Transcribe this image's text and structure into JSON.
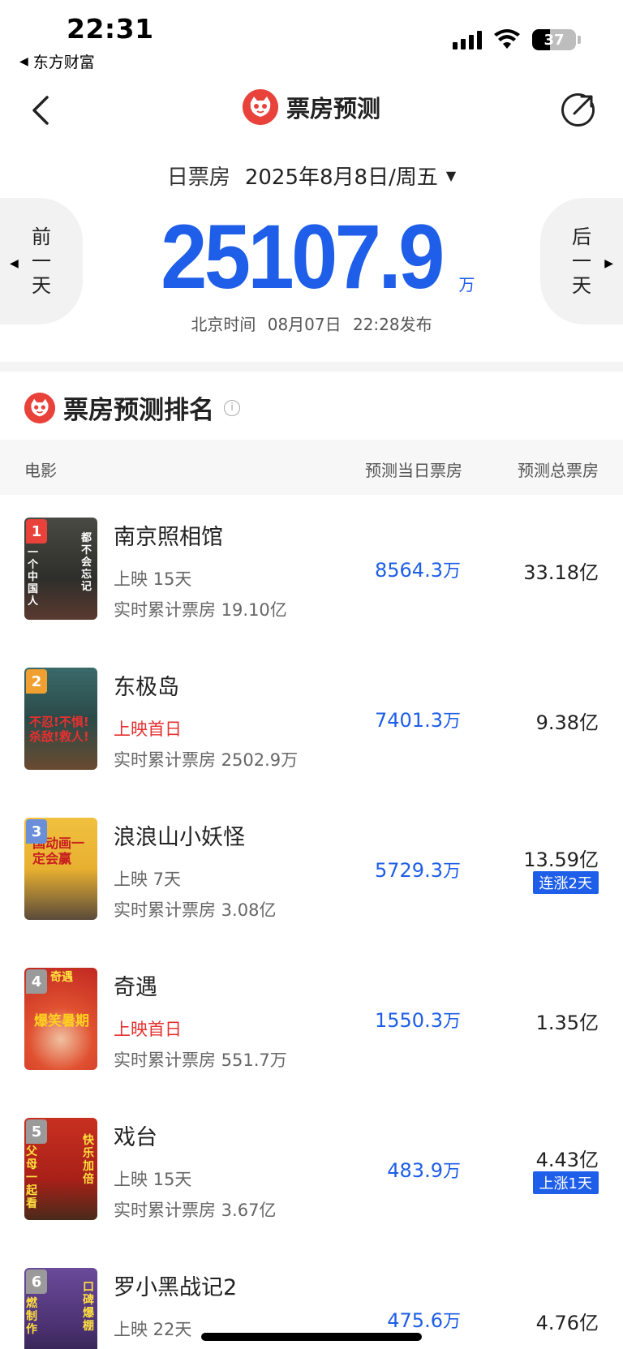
{
  "status_bar": {
    "time": "22:31",
    "back_app": "东方财富",
    "battery": "37"
  },
  "nav": {
    "title": "票房预测"
  },
  "date_section": {
    "label": "日票房",
    "date": "2025年8月8日/周五",
    "prev": [
      "前",
      "一",
      "天"
    ],
    "next": [
      "后",
      "一",
      "天"
    ],
    "box_office": "25107.9",
    "unit": "万",
    "publish_prefix": "北京时间",
    "publish_date": "08月07日",
    "publish_time": "22:28发布"
  },
  "ranking": {
    "title": "票房预测排名",
    "columns": {
      "movie": "电影",
      "daily": "预测当日票房",
      "total": "预测总票房"
    },
    "movies": [
      {
        "rank": "1",
        "title": "南京照相馆",
        "days": "上映 15天",
        "is_first_day": false,
        "cumulative": "实时累计票房 19.10亿",
        "daily": "8564.3",
        "daily_unit": "万",
        "total": "33.18亿",
        "tag": "",
        "badge_color": "#e8423a",
        "poster_color": "#3a3a36"
      },
      {
        "rank": "2",
        "title": "东极岛",
        "days": "上映首日",
        "is_first_day": true,
        "cumulative": "实时累计票房 2502.9万",
        "daily": "7401.3",
        "daily_unit": "万",
        "total": "9.38亿",
        "tag": "",
        "badge_color": "#f0a030",
        "poster_color": "#2f5a5a"
      },
      {
        "rank": "3",
        "title": "浪浪山小妖怪",
        "days": "上映 7天",
        "is_first_day": false,
        "cumulative": "实时累计票房 3.08亿",
        "daily": "5729.3",
        "daily_unit": "万",
        "total": "13.59亿",
        "tag": "连涨2天",
        "badge_color": "#6a8fd8",
        "poster_color": "#e8b830"
      },
      {
        "rank": "4",
        "title": "奇遇",
        "days": "上映首日",
        "is_first_day": true,
        "cumulative": "实时累计票房 551.7万",
        "daily": "1550.3",
        "daily_unit": "万",
        "total": "1.35亿",
        "tag": "",
        "badge_color": "#9a9a9a",
        "poster_color": "#c8302a"
      },
      {
        "rank": "5",
        "title": "戏台",
        "days": "上映 15天",
        "is_first_day": false,
        "cumulative": "实时累计票房 3.67亿",
        "daily": "483.9",
        "daily_unit": "万",
        "total": "4.43亿",
        "tag": "上涨1天",
        "badge_color": "#9a9a9a",
        "poster_color": "#b8281e"
      },
      {
        "rank": "6",
        "title": "罗小黑战记2",
        "days": "上映 22天",
        "is_first_day": false,
        "cumulative": "",
        "daily": "475.6",
        "daily_unit": "万",
        "total": "4.76亿",
        "tag": "",
        "badge_color": "#9a9a9a",
        "poster_color": "#5a3a7a"
      }
    ]
  },
  "poster_texts": {
    "m1_left": "一个中国人",
    "m1_right": "都不会忘记",
    "m2": "不忍!不惧!杀敌!救人!",
    "m3": "国动画一定会赢",
    "m4": "奇遇",
    "m4_b": "爆笑暑期",
    "m5_left": "父母一起看",
    "m5_right": "快乐加倍",
    "m6_left": "燃制作",
    "m6_right": "口碑爆棚"
  },
  "colors": {
    "accent_blue": "#1e5ee8",
    "brand_red": "#e8423a",
    "first_day_red": "#e63030"
  }
}
